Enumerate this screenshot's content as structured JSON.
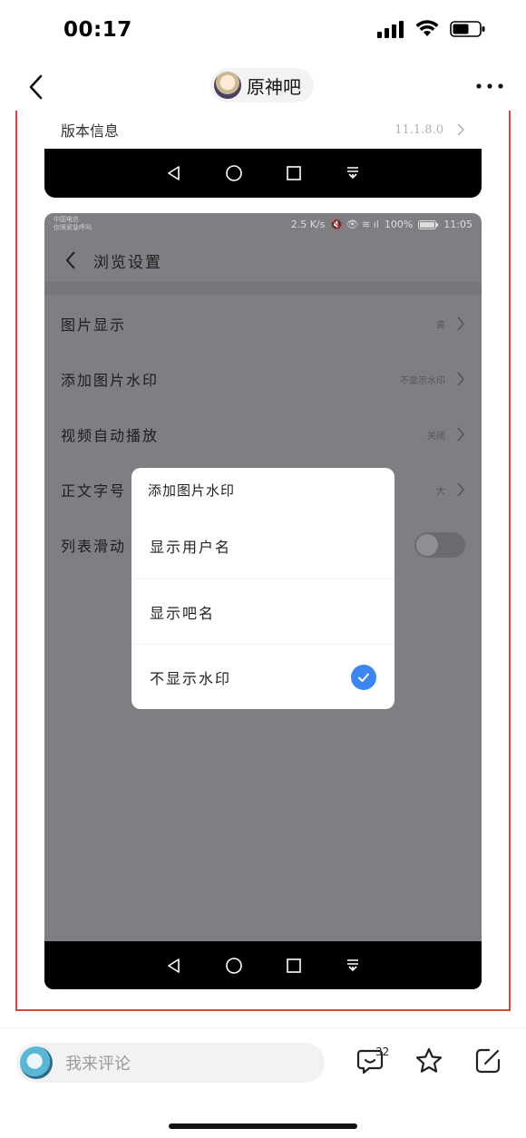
{
  "status_bar": {
    "time": "00:17"
  },
  "nav": {
    "forum_name": "原神吧"
  },
  "shot1": {
    "version_label": "版本信息",
    "version_value": "11.1.8.0"
  },
  "shot2": {
    "status": {
      "carrier_line1": "中国电信",
      "carrier_line2": "仅限紧急呼叫",
      "speed": "2.5 K/s",
      "battery": "100%",
      "time": "11:05"
    },
    "title": "浏览设置",
    "rows": [
      {
        "label": "图片显示",
        "value": "高"
      },
      {
        "label": "添加图片水印",
        "value": "不显示水印"
      },
      {
        "label": "视频自动播放",
        "value": "关闭"
      },
      {
        "label": "正文字号",
        "value": "大"
      },
      {
        "label": "列表滑动",
        "value": ""
      }
    ]
  },
  "dialog": {
    "title": "添加图片水印",
    "options": [
      {
        "label": "显示用户名",
        "selected": false
      },
      {
        "label": "显示吧名",
        "selected": false
      },
      {
        "label": "不显示水印",
        "selected": true
      }
    ],
    "accent": "#3d86f0"
  },
  "bottom": {
    "comment_placeholder": "我来评论",
    "reaction_count": "32"
  }
}
